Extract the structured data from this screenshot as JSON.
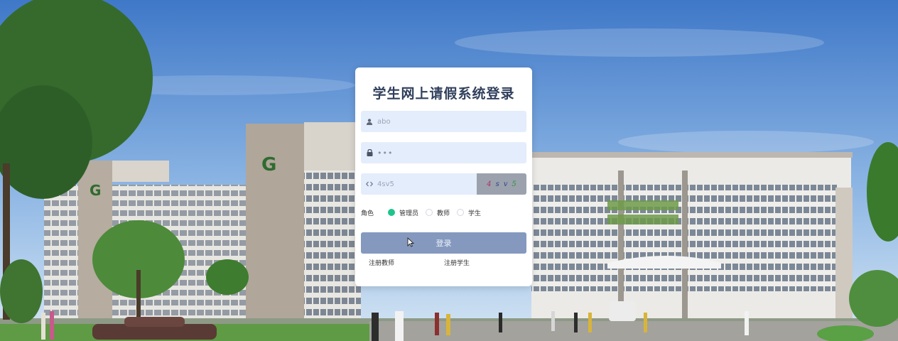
{
  "login": {
    "title": "学生网上请假系统登录",
    "username_value": "abo",
    "password_value": "•••",
    "captcha_input_value": "4sv5",
    "captcha_chars": [
      {
        "ch": "4",
        "color": "#b0306a"
      },
      {
        "ch": "s",
        "color": "#2e3f8f"
      },
      {
        "ch": "v",
        "color": "#2e3f8f"
      },
      {
        "ch": "5",
        "color": "#2e8f3f"
      }
    ],
    "role_label": "角色",
    "roles": [
      {
        "label": "管理员",
        "checked": true
      },
      {
        "label": "教师",
        "checked": false
      },
      {
        "label": "学生",
        "checked": false
      }
    ],
    "login_button": "登录",
    "register_teacher": "注册教师",
    "register_student": "注册学生"
  },
  "colors": {
    "accent_radio": "#1fc48d",
    "button": "#8599bf",
    "field_bg": "#e4edfb",
    "title": "#303f5c"
  }
}
